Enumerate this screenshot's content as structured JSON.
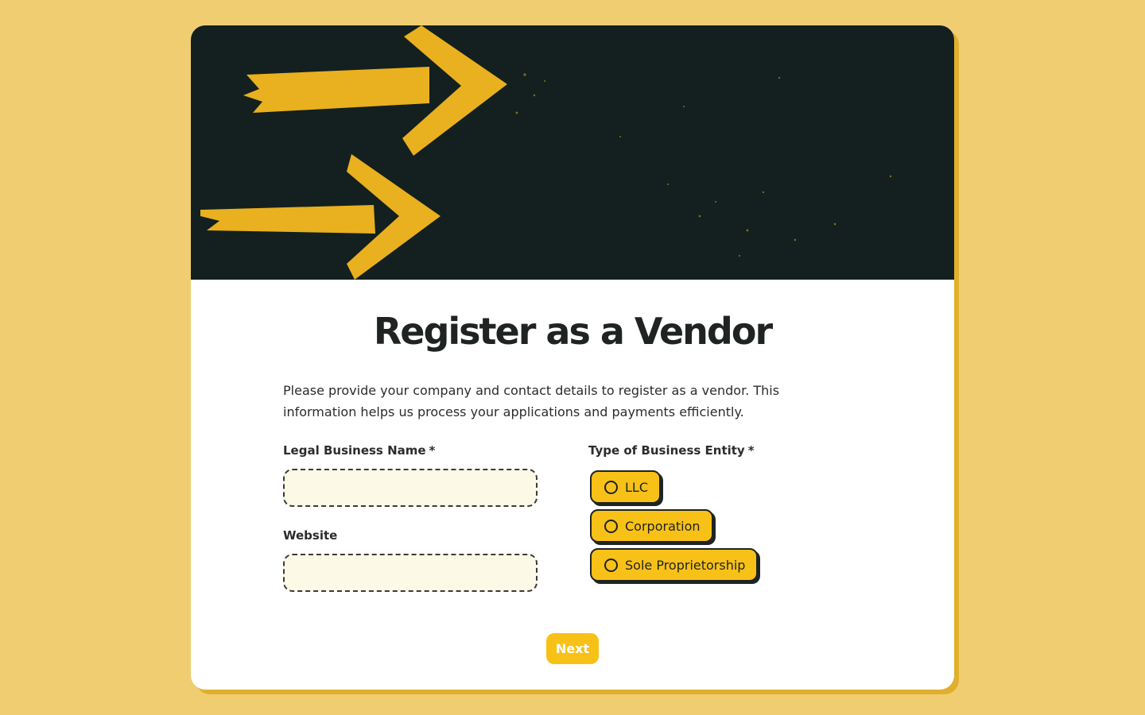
{
  "form": {
    "title": "Register as a Vendor",
    "intro_line1": "Please provide your company and contact details to register as a vendor. This",
    "intro_line2": "information helps us process your applications and payments efficiently.",
    "legal_name_label": "Legal Business Name",
    "required_marker": "*",
    "legal_name_value": "",
    "website_label": "Website",
    "website_value": "",
    "entity_label": "Type of Business Entity",
    "entity_options": [
      "LLC",
      "Corporation",
      "Sole Proprietorship"
    ],
    "next_label": "Next"
  },
  "colors": {
    "page_background": "#f1cd72",
    "banner_background": "#13201f",
    "accent_yellow": "#f8c117",
    "input_fill": "#fdf9e7",
    "text_dark": "#1f2422"
  },
  "icons": {
    "banner": "yellow-arrows-illustration",
    "radio": "radio-circle-icon"
  }
}
